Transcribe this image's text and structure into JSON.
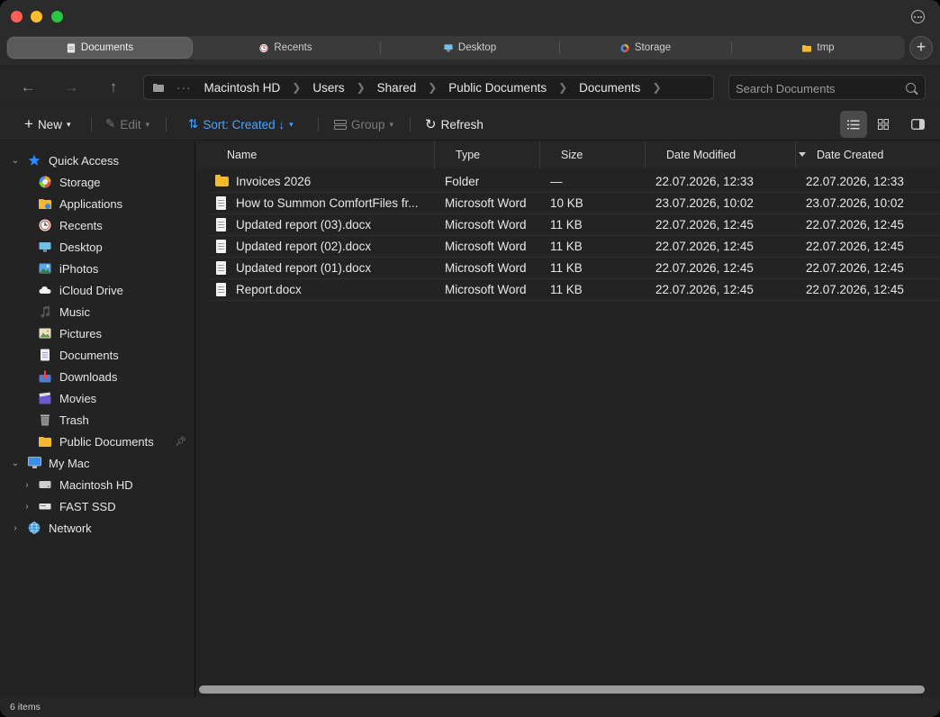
{
  "tabs": [
    {
      "label": "Documents",
      "icon": "document-icon",
      "active": true
    },
    {
      "label": "Recents",
      "icon": "clock-icon",
      "active": false
    },
    {
      "label": "Desktop",
      "icon": "desktop-icon",
      "active": false
    },
    {
      "label": "Storage",
      "icon": "storage-icon",
      "active": false
    },
    {
      "label": "tmp",
      "icon": "folder-icon",
      "active": false
    }
  ],
  "breadcrumb": {
    "ellipsis": "···",
    "items": [
      "Macintosh HD",
      "Users",
      "Shared",
      "Public Documents",
      "Documents"
    ]
  },
  "search": {
    "placeholder": "Search Documents"
  },
  "toolbar": {
    "new_label": "New",
    "edit_label": "Edit",
    "sort_label": "Sort: Created ↓",
    "group_label": "Group",
    "refresh_label": "Refresh"
  },
  "sidebar": {
    "quick_access": {
      "label": "Quick Access",
      "items": [
        {
          "label": "Storage",
          "icon": "storage-icon"
        },
        {
          "label": "Applications",
          "icon": "applications-folder-icon"
        },
        {
          "label": "Recents",
          "icon": "clock-icon"
        },
        {
          "label": "Desktop",
          "icon": "desktop-icon"
        },
        {
          "label": "iPhotos",
          "icon": "photos-icon"
        },
        {
          "label": "iCloud Drive",
          "icon": "cloud-icon"
        },
        {
          "label": "Music",
          "icon": "music-icon"
        },
        {
          "label": "Pictures",
          "icon": "pictures-icon"
        },
        {
          "label": "Documents",
          "icon": "document-icon"
        },
        {
          "label": "Downloads",
          "icon": "downloads-icon"
        },
        {
          "label": "Movies",
          "icon": "movies-icon"
        },
        {
          "label": "Trash",
          "icon": "trash-icon"
        },
        {
          "label": "Public Documents",
          "icon": "folder-icon",
          "pinned": true
        }
      ]
    },
    "my_mac": {
      "label": "My Mac",
      "items": [
        {
          "label": "Macintosh HD",
          "icon": "drive-icon"
        },
        {
          "label": "FAST SSD",
          "icon": "external-drive-icon"
        }
      ]
    },
    "network": {
      "label": "Network",
      "icon": "globe-icon"
    }
  },
  "table": {
    "columns": [
      "Name",
      "Type",
      "Size",
      "Date Modified",
      "Date Created"
    ],
    "rows": [
      {
        "name": "Invoices 2026",
        "type": "Folder",
        "size": "—",
        "modified": "22.07.2026, 12:33",
        "created": "22.07.2026, 12:33",
        "kind": "folder"
      },
      {
        "name": "How to Summon ComfortFiles fr...",
        "type": "Microsoft Word",
        "size": "10 KB",
        "modified": "23.07.2026, 10:02",
        "created": "23.07.2026, 10:02",
        "kind": "file"
      },
      {
        "name": "Updated report (03).docx",
        "type": "Microsoft Word",
        "size": "11 KB",
        "modified": "22.07.2026, 12:45",
        "created": "22.07.2026, 12:45",
        "kind": "file"
      },
      {
        "name": "Updated report (02).docx",
        "type": "Microsoft Word",
        "size": "11 KB",
        "modified": "22.07.2026, 12:45",
        "created": "22.07.2026, 12:45",
        "kind": "file"
      },
      {
        "name": "Updated report (01).docx",
        "type": "Microsoft Word",
        "size": "11 KB",
        "modified": "22.07.2026, 12:45",
        "created": "22.07.2026, 12:45",
        "kind": "file"
      },
      {
        "name": "Report.docx",
        "type": "Microsoft Word",
        "size": "11 KB",
        "modified": "22.07.2026, 12:45",
        "created": "22.07.2026, 12:45",
        "kind": "file"
      }
    ]
  },
  "status": {
    "item_count": "6 items"
  },
  "colors": {
    "accent": "#4aa3ff",
    "folder": "#f5b82e",
    "close": "#ff5f57",
    "minimize": "#febc2e",
    "zoom": "#28c840"
  }
}
